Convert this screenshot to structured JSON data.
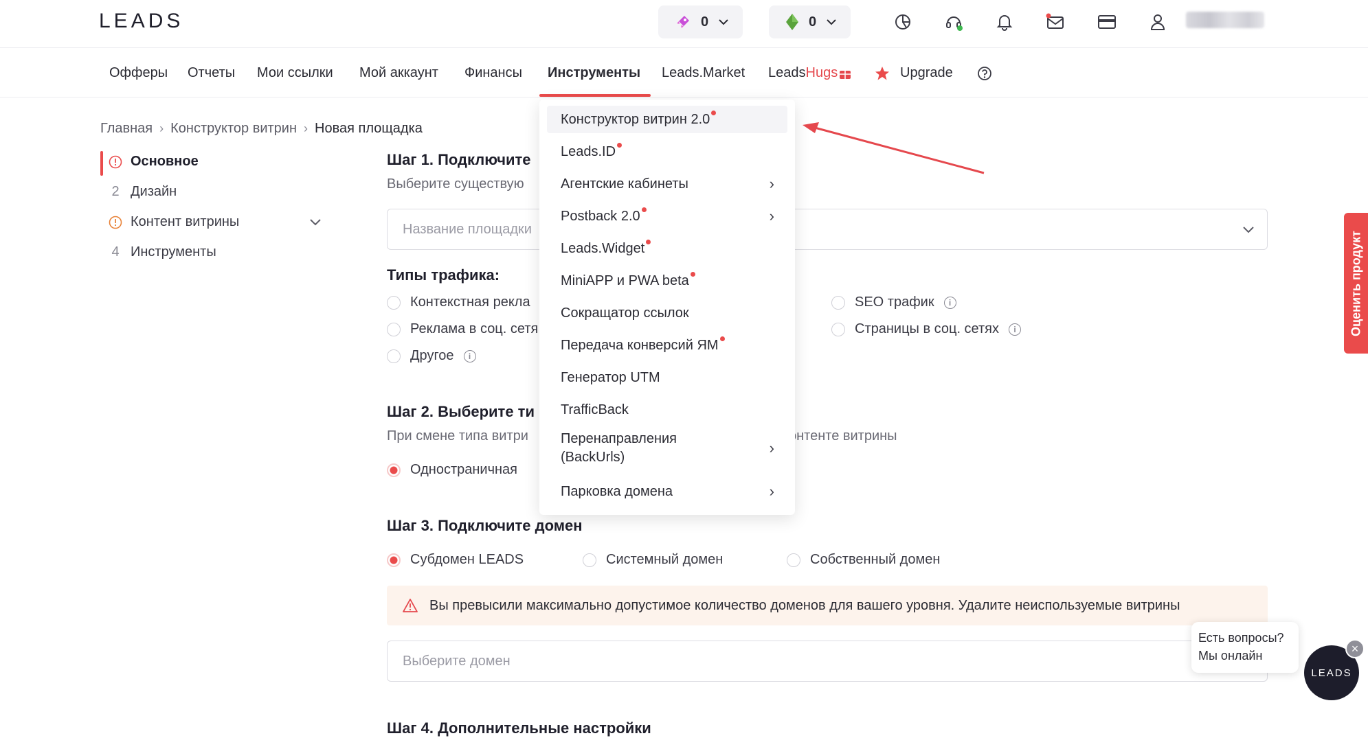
{
  "header": {
    "logo": "LEADS",
    "wallet_rub": {
      "value": "0",
      "icon": "rocket-icon"
    },
    "wallet_gems": {
      "value": "0",
      "icon": "gem-icon"
    },
    "icons": [
      "stats-icon",
      "support-headset-icon",
      "bell-icon",
      "mail-icon",
      "card-icon",
      "user-icon"
    ]
  },
  "nav": {
    "items": [
      {
        "label": "Офферы"
      },
      {
        "label": "Отчеты"
      },
      {
        "label": "Мои ссылки"
      },
      {
        "label": "Мой аккаунт"
      },
      {
        "label": "Финансы"
      },
      {
        "label": "Инструменты"
      },
      {
        "label": "Leads.Market"
      },
      {
        "label_leads": "Leads",
        "label_hugs": "Hugs"
      },
      {
        "label": "Upgrade"
      }
    ]
  },
  "breadcrumb": {
    "items": [
      "Главная",
      "Конструктор витрин",
      "Новая площадка"
    ]
  },
  "steps": [
    {
      "label": "Основное",
      "marker": "!"
    },
    {
      "label": "Дизайн",
      "marker": "2"
    },
    {
      "label": "Контент витрины",
      "marker": "!"
    },
    {
      "label": "Инструменты",
      "marker": "4"
    }
  ],
  "form": {
    "step1_title": "Шаг 1. Подключите",
    "step1_sub": "Выберите существую",
    "site_name_placeholder": "Название площадки",
    "traffic_title": "Типы трафика:",
    "traffic": [
      {
        "label": "Контекстная рекла"
      },
      {
        "label": "Реклама в соц. сетя"
      },
      {
        "label": "Другое"
      },
      {
        "label": "SEO трафик"
      },
      {
        "label": "Страницы в соц. сетях"
      }
    ],
    "step2_title": "Шаг 2. Выберите ти",
    "step2_sub_left": "При смене типа витри",
    "step2_sub_right": "онтенте витрины",
    "step2_option": "Одностраничная",
    "step3_title": "Шаг 3. Подключите домен",
    "domain_options": [
      "Субдомен LEADS",
      "Системный домен",
      "Собственный домен"
    ],
    "warning": "Вы превысили максимально допустимое количество доменов для вашего уровня. Удалите неиспользуемые витрины",
    "domain_placeholder": "Выберите домен",
    "step4_title": "Шаг 4. Дополнительные настройки"
  },
  "menu": {
    "items": [
      {
        "label": "Конструктор витрин 2.0",
        "dot": true,
        "submenu": false
      },
      {
        "label": "Leads.ID",
        "dot": true,
        "submenu": false
      },
      {
        "label": "Агентские кабинеты",
        "dot": false,
        "submenu": true
      },
      {
        "label": "Postback 2.0",
        "dot": true,
        "submenu": true
      },
      {
        "label": "Leads.Widget",
        "dot": true,
        "submenu": false
      },
      {
        "label": "MiniAPP и PWA beta",
        "dot": true,
        "submenu": false
      },
      {
        "label": "Сокращатор ссылок",
        "dot": false,
        "submenu": false
      },
      {
        "label": "Передача конверсий ЯМ",
        "dot": true,
        "submenu": false
      },
      {
        "label": "Генератор UTM",
        "dot": false,
        "submenu": false
      },
      {
        "label": "TrafficBack",
        "dot": false,
        "submenu": false
      },
      {
        "label_line1": "Перенаправления",
        "label_line2": "(BackUrls)",
        "dot": false,
        "submenu": true
      },
      {
        "label": "Парковка домена",
        "dot": false,
        "submenu": true
      }
    ]
  },
  "widgets": {
    "rate_tab": "Оценить продукт",
    "chat_line1": "Есть вопросы?",
    "chat_line2": "Мы онлайн",
    "chat_logo": "LEADS"
  },
  "colors": {
    "accent": "#ea4b4b",
    "dark": "#1d1d2b",
    "warning_bg": "#fdf3ec"
  }
}
